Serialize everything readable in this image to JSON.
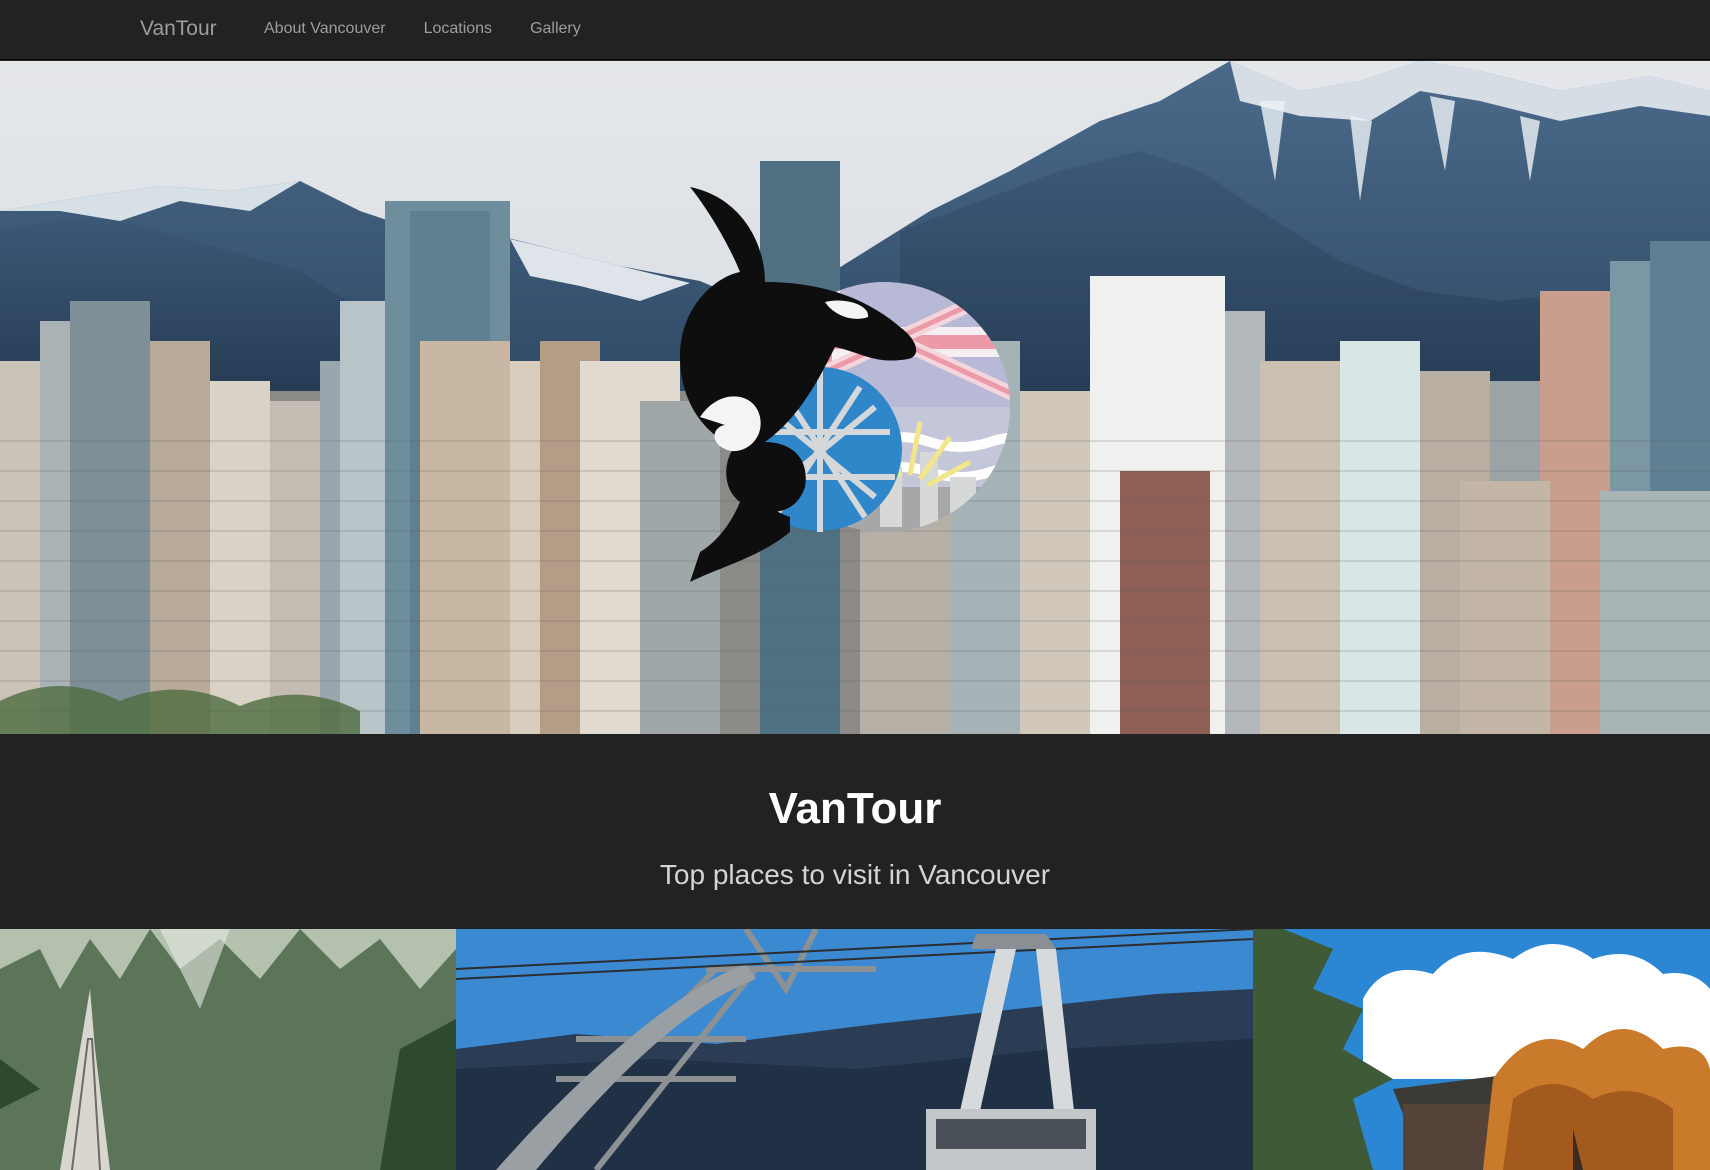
{
  "nav": {
    "brand": "VanTour",
    "links": [
      {
        "label": "About Vancouver"
      },
      {
        "label": "Locations"
      },
      {
        "label": "Gallery"
      }
    ]
  },
  "hero": {
    "image": "vancouver-skyline-with-mountains",
    "logo": "orca-bc-flag-science-world-logo"
  },
  "intro": {
    "title": "VanTour",
    "tagline": "Top places to visit in Vancouver"
  },
  "gallery": [
    {
      "image": "suspension-bridge-forest"
    },
    {
      "image": "gondola-mountain-tram"
    },
    {
      "image": "chinese-garden-autumn-tree"
    }
  ],
  "colors": {
    "navbar_bg": "#222222",
    "nav_text": "#9d9d9d",
    "title_text": "#ffffff",
    "tagline_text": "#d4d4d4"
  }
}
